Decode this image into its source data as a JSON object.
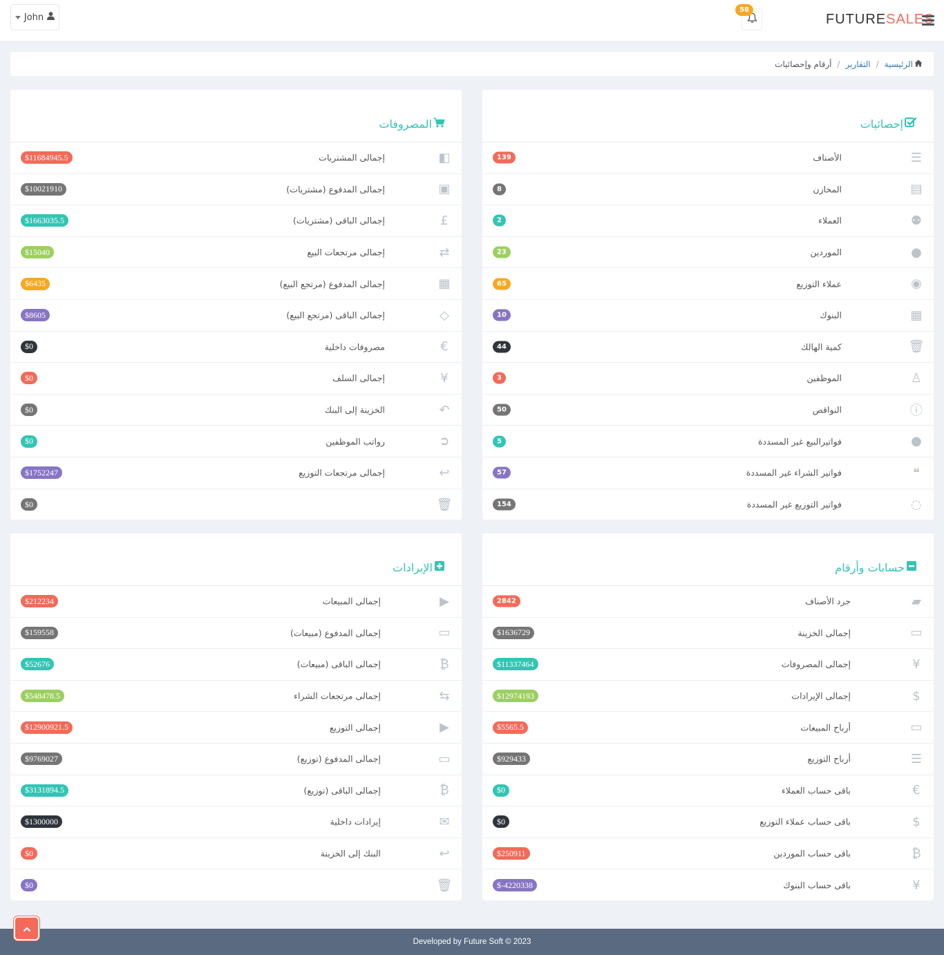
{
  "header": {
    "user_name": "John",
    "notification_count": "58",
    "brand_part1": "FUTURE",
    "brand_part2": "SALES"
  },
  "breadcrumb": {
    "home": "الرئيسية",
    "reports": "التقارير",
    "current": "أرقام وإحصائيات",
    "separator": "/"
  },
  "colors": {
    "red": "#f36a5a",
    "gray": "#757575",
    "teal": "#32c5b3",
    "lime": "#9ccf61",
    "yellow": "#f7a823",
    "purple": "#8775c4",
    "dark": "#2f353b",
    "accent": "#32c5b3"
  },
  "panels": {
    "stats": {
      "title": "إحصائيات",
      "icon": "check-square-icon",
      "rows": [
        {
          "label": "الأصناف",
          "value": "139",
          "color": "#f36a5a",
          "icon": "list-icon"
        },
        {
          "label": "المخازن",
          "value": "8",
          "color": "#757575",
          "icon": "archive-icon"
        },
        {
          "label": "العملاء",
          "value": "2",
          "color": "#32c5b3",
          "icon": "users-icon"
        },
        {
          "label": "الموردين",
          "value": "23",
          "color": "#9ccf61",
          "icon": "user-icon"
        },
        {
          "label": "عملاء التوزيع",
          "value": "65",
          "color": "#f7a823",
          "icon": "user-circle-icon"
        },
        {
          "label": "البنوك",
          "value": "10",
          "color": "#8775c4",
          "icon": "building-icon"
        },
        {
          "label": "كمية الهالك",
          "value": "44",
          "color": "#2f353b",
          "icon": "trash-icon"
        },
        {
          "label": "الموظفين",
          "value": "3",
          "color": "#f36a5a",
          "icon": "male-icon"
        },
        {
          "label": "النواقص",
          "value": "50",
          "color": "#757575",
          "icon": "info-circle-icon"
        },
        {
          "label": "فواتيرالبيع غير المسددة",
          "value": "5",
          "color": "#32c5b3",
          "icon": "comment-icon"
        },
        {
          "label": "فواتير الشراء غير المسددة",
          "value": "57",
          "color": "#8775c4",
          "icon": "comments-icon"
        },
        {
          "label": "فواتير التوزيع غير المسددة",
          "value": "154",
          "color": "#757575",
          "icon": "commenting-icon"
        }
      ]
    },
    "expenses": {
      "title": "المصروفات",
      "icon": "shopping-cart-icon",
      "rows": [
        {
          "label": "إجمالى المشتريات",
          "value": "$11684945.5",
          "color": "#f36a5a",
          "icon": "caret-square-left-icon"
        },
        {
          "label": "إجمالى المدفوع (مشتريات)",
          "value": "$10021910",
          "color": "#757575",
          "icon": "briefcase-icon"
        },
        {
          "label": "إجمالى الباقى (مشتريات)",
          "value": "$1663035.5",
          "color": "#32c5b3",
          "icon": "gbp-icon"
        },
        {
          "label": "إجمالى مرتجعات البيع",
          "value": "$15040",
          "color": "#9ccf61",
          "icon": "retweet-icon"
        },
        {
          "label": "إجمالى المدفوع (مرتجع البيع)",
          "value": "$6435",
          "color": "#f7a823",
          "icon": "calendar-icon"
        },
        {
          "label": "إجمالى الباقى (مرتجع البيع)",
          "value": "$8605",
          "color": "#8775c4",
          "icon": "ticket-icon"
        },
        {
          "label": "مصروفات داخلية",
          "value": "$0",
          "color": "#2f353b",
          "icon": "euro-icon"
        },
        {
          "label": "إجمالى السلف",
          "value": "$0",
          "color": "#f36a5a",
          "icon": "yen-icon"
        },
        {
          "label": "الخزينة إلى البنك",
          "value": "$0",
          "color": "#757575",
          "icon": "reply-all-icon"
        },
        {
          "label": "رواتب الموظفين",
          "value": "$0",
          "color": "#32c5b3",
          "icon": "arrow-circle-right-icon"
        },
        {
          "label": "إجمالى مرتجعات التوزيع",
          "value": "$1752247",
          "color": "#8775c4",
          "icon": "reply-icon"
        },
        {
          "label": "",
          "value": "$0",
          "color": "#757575",
          "icon": "trash-icon"
        }
      ]
    },
    "accounts": {
      "title": "حسابات وأرقام",
      "icon": "minus-square-icon",
      "rows": [
        {
          "label": "جرد الأصناف",
          "value": "2842",
          "color": "#f36a5a",
          "icon": "book-icon"
        },
        {
          "label": "إجمالى الخزينة",
          "value": "$1636729",
          "color": "#757575",
          "icon": "money-icon"
        },
        {
          "label": "إجمالى المصروفات",
          "value": "$11337464",
          "color": "#32c5b3",
          "icon": "yen-icon"
        },
        {
          "label": "إجمالى الإيرادات",
          "value": "$12974193",
          "color": "#9ccf61",
          "icon": "dollar-icon"
        },
        {
          "label": "أرباح المبيعات",
          "value": "$5565.5",
          "color": "#f36a5a",
          "icon": "inbox-icon"
        },
        {
          "label": "أرباح التوزيع",
          "value": "$929433",
          "color": "#757575",
          "icon": "indent-icon"
        },
        {
          "label": "باقى حساب العملاء",
          "value": "$0",
          "color": "#32c5b3",
          "icon": "euro-icon"
        },
        {
          "label": "باقى حساب عملاء التوزيع",
          "value": "$0",
          "color": "#2f353b",
          "icon": "dollar-icon"
        },
        {
          "label": "باقى حساب الموردين",
          "value": "$250911",
          "color": "#f36a5a",
          "icon": "bitcoin-icon"
        },
        {
          "label": "باقى حساب البنوك",
          "value": "$-4220338",
          "color": "#8775c4",
          "icon": "yen-icon"
        }
      ]
    },
    "revenues": {
      "title": "الإيرادات",
      "icon": "plus-square-icon",
      "rows": [
        {
          "label": "إجمالى المبيعات",
          "value": "$212234",
          "color": "#f36a5a",
          "icon": "play-square-icon"
        },
        {
          "label": "إجمالى المدفوع (مبيعات)",
          "value": "$159558",
          "color": "#757575",
          "icon": "money-icon"
        },
        {
          "label": "إجمالى الباقى (مبيعات)",
          "value": "$52676",
          "color": "#32c5b3",
          "icon": "bitcoin-icon"
        },
        {
          "label": "إجمالى مرتجعات الشراء",
          "value": "$548478.5",
          "color": "#9ccf61",
          "icon": "exchange-icon"
        },
        {
          "label": "إجمالى التوزيع",
          "value": "$12900921.5",
          "color": "#f36a5a",
          "icon": "play-square-icon"
        },
        {
          "label": "إجمالى المدفوع (توزيع)",
          "value": "$9769027",
          "color": "#757575",
          "icon": "money-icon"
        },
        {
          "label": "إجمالى الباقى (توزيع)",
          "value": "$3131894.5",
          "color": "#32c5b3",
          "icon": "bitcoin-icon"
        },
        {
          "label": "إيرادات داخلية",
          "value": "$1300000",
          "color": "#2f353b",
          "icon": "envelope-icon"
        },
        {
          "label": "البنك إلى الخزينة",
          "value": "$0",
          "color": "#f36a5a",
          "icon": "reply-icon"
        },
        {
          "label": "",
          "value": "$0",
          "color": "#8775c4",
          "icon": "trash-icon"
        }
      ]
    }
  },
  "footer": {
    "text": "Developed by Future Soft © 2023"
  }
}
